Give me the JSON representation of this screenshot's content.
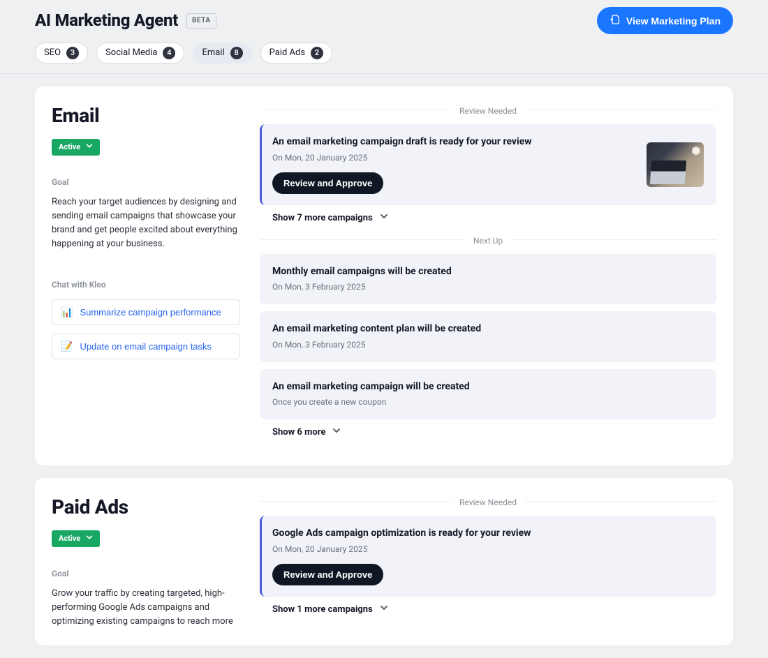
{
  "header": {
    "title": "AI Marketing Agent",
    "beta_label": "BETA",
    "plan_button": "View Marketing Plan"
  },
  "filters": [
    {
      "label": "SEO",
      "count": 3,
      "active": false
    },
    {
      "label": "Social Media",
      "count": 4,
      "active": false
    },
    {
      "label": "Email",
      "count": 8,
      "active": true
    },
    {
      "label": "Paid Ads",
      "count": 2,
      "active": false
    }
  ],
  "sections": {
    "email": {
      "title": "Email",
      "status": "Active",
      "goal_label": "Goal",
      "goal_text": "Reach your target audiences by designing and sending email campaigns that showcase your brand and get people excited about everything happening at your business.",
      "chat_label": "Chat with Kleo",
      "prompts": [
        {
          "emoji": "📊",
          "label": "Summarize campaign performance"
        },
        {
          "emoji": "📝",
          "label": "Update on email campaign tasks"
        }
      ],
      "review_label": "Review Needed",
      "review_task": {
        "title": "An email marketing campaign draft is ready for your review",
        "sub": "On Mon, 20 January 2025",
        "cta": "Review and Approve"
      },
      "show_more_review": "Show 7 more campaigns",
      "nextup_label": "Next Up",
      "next_tasks": [
        {
          "title": "Monthly email campaigns will be created",
          "sub": "On Mon, 3 February 2025"
        },
        {
          "title": "An email marketing content plan will be created",
          "sub": "On Mon, 3 February 2025"
        },
        {
          "title": "An email marketing campaign will be created",
          "sub": "Once you create a new coupon"
        }
      ],
      "show_more_next": "Show 6 more"
    },
    "paid": {
      "title": "Paid Ads",
      "status": "Active",
      "goal_label": "Goal",
      "goal_text": "Grow your traffic by creating targeted, high-performing Google Ads campaigns and optimizing existing campaigns to reach more",
      "review_label": "Review Needed",
      "review_task": {
        "title": "Google Ads campaign optimization is ready for your review",
        "sub": "On Mon, 20 January 2025",
        "cta": "Review and Approve"
      },
      "show_more_review": "Show 1 more campaigns"
    }
  }
}
